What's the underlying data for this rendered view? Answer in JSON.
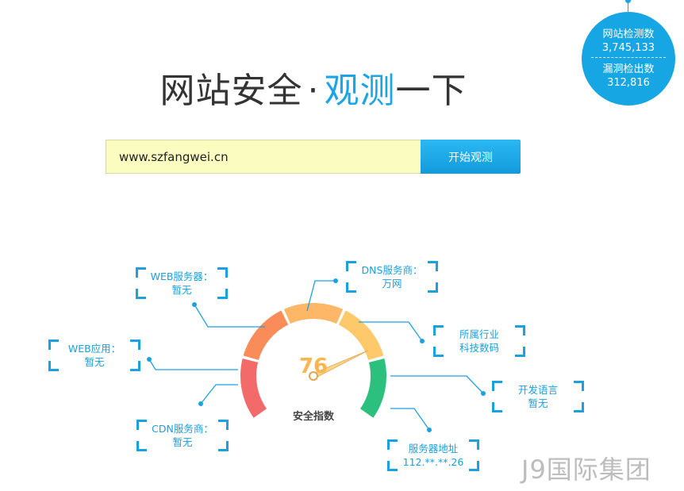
{
  "title": {
    "part1": "网站安全",
    "dot": "·",
    "part2": "观测",
    "part3": "一下"
  },
  "stats": {
    "sites_label": "网站检测数",
    "sites_value": "3,745,133",
    "vulns_label": "漏洞检出数",
    "vulns_value": "312,816"
  },
  "search": {
    "value": "www.szfangwei.cn",
    "button_label": "开始观测"
  },
  "gauge": {
    "score": "76",
    "score_value": 76,
    "label": "安全指数",
    "colors": [
      "#f26a6a",
      "#fa8c59",
      "#fdb766",
      "#fdc96a",
      "#2cc07f"
    ]
  },
  "info_boxes": {
    "web_server": {
      "label": "WEB服务器：",
      "value": "暂无"
    },
    "dns": {
      "label": "DNS服务商：",
      "value": "万网"
    },
    "industry": {
      "label": "所属行业",
      "value": "科技数码"
    },
    "web_app": {
      "label": "WEB应用：",
      "value": "暂无"
    },
    "language": {
      "label": "开发语言",
      "value": "暂无"
    },
    "cdn": {
      "label": "CDN服务商：",
      "value": "暂无"
    },
    "server_ip": {
      "label": "服务器地址",
      "value": "112.**.**.26"
    }
  },
  "watermark": "J9国际集团"
}
